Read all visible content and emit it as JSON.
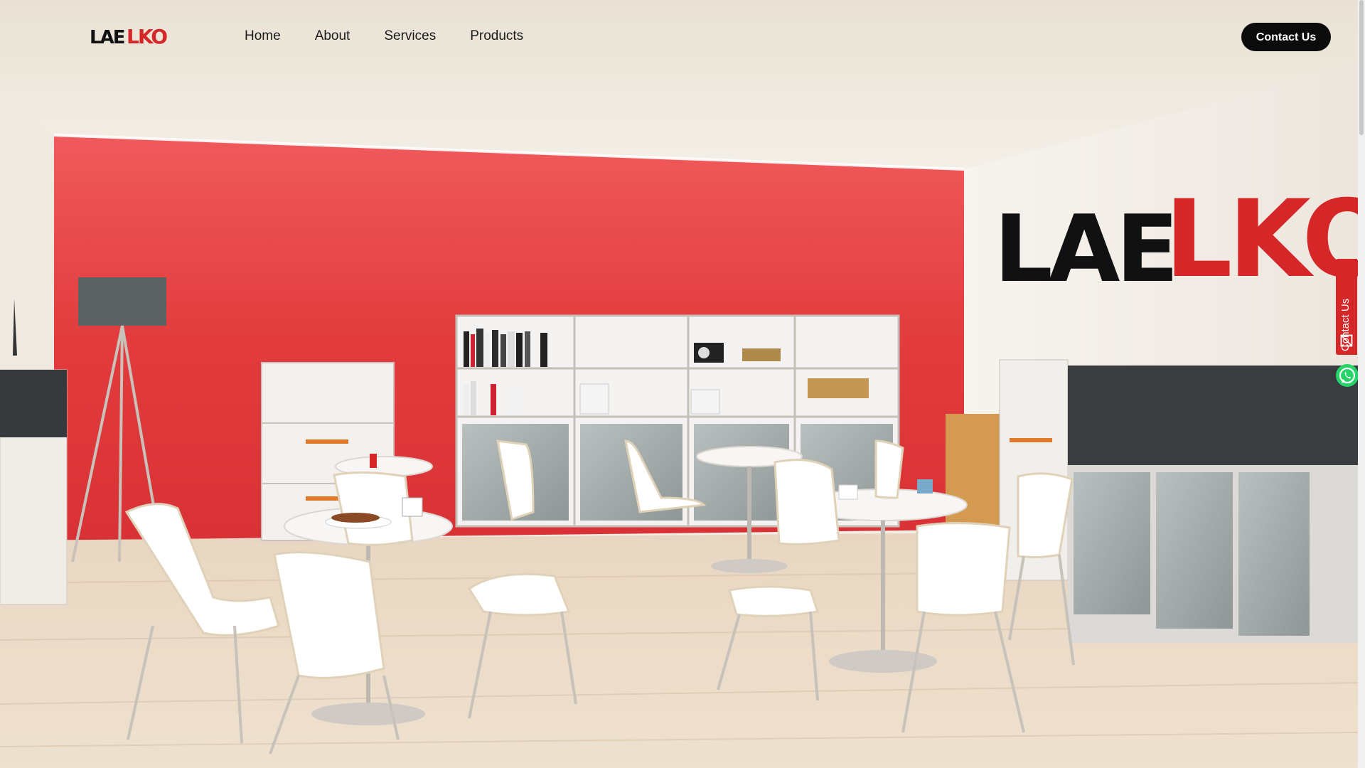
{
  "brand": {
    "name": "LAELKO",
    "accent_color": "#d62728",
    "dark_color": "#111111"
  },
  "nav": {
    "items": [
      {
        "label": "Home"
      },
      {
        "label": "About"
      },
      {
        "label": "Services"
      },
      {
        "label": "Products"
      }
    ]
  },
  "header": {
    "contact_button": "Contact Us"
  },
  "side_widgets": {
    "contact_tab": "Contact Us",
    "contact_icon": "mail-icon",
    "chat_icon": "whatsapp-icon"
  },
  "hero": {
    "image_semantic": "office-cafeteria-scene",
    "wall_color": "#e23c3e"
  }
}
